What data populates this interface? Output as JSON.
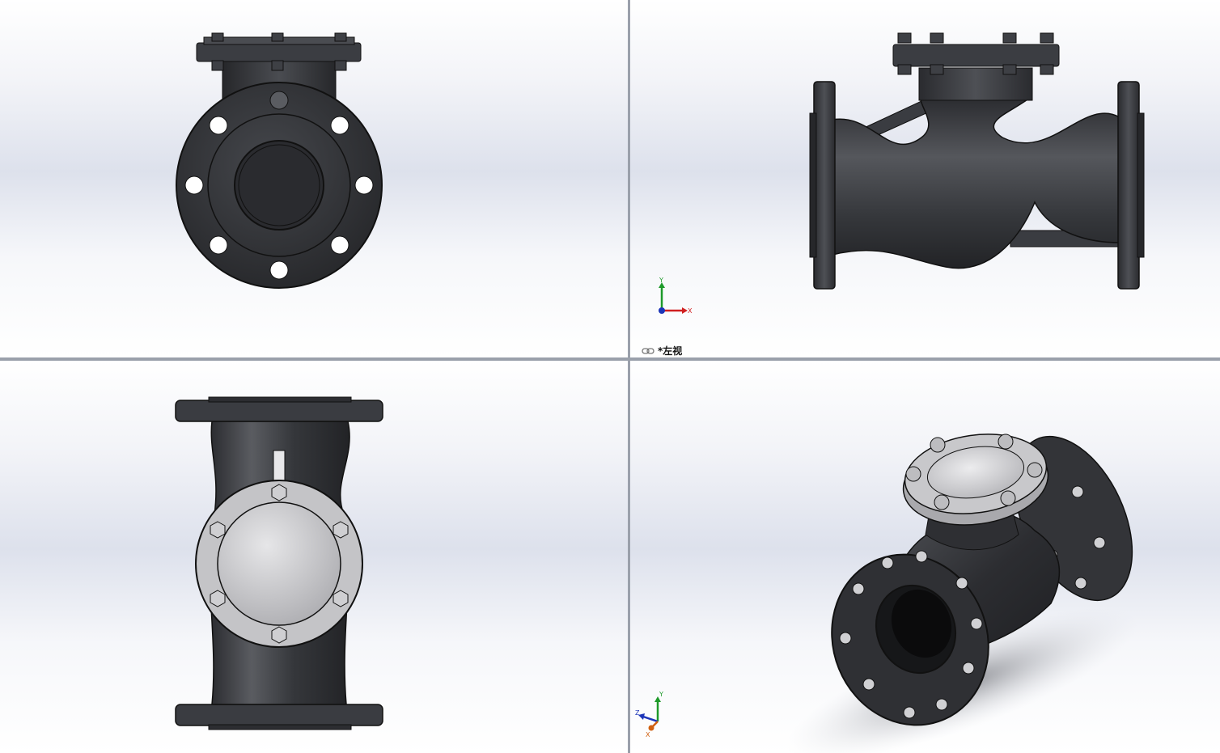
{
  "viewports": [
    {
      "id": "top-left",
      "view": "front"
    },
    {
      "id": "top-right",
      "view": "left",
      "label": "*左视",
      "label_icon": "link-icon"
    },
    {
      "id": "bottom-left",
      "view": "top"
    },
    {
      "id": "bottom-right",
      "view": "isometric"
    }
  ],
  "triad_top_right": {
    "x": "X",
    "y": "Y"
  },
  "triad_bottom_right": {
    "x": "X",
    "y": "Y",
    "z": "Z"
  },
  "colors": {
    "body": "#2e2f33",
    "body_highlight": "#55575c",
    "cover": "#c9c9cb",
    "divider": "#9aa0ab",
    "axis_x": "#d02020",
    "axis_y": "#1e9a2a",
    "axis_z": "#1c35b8"
  }
}
